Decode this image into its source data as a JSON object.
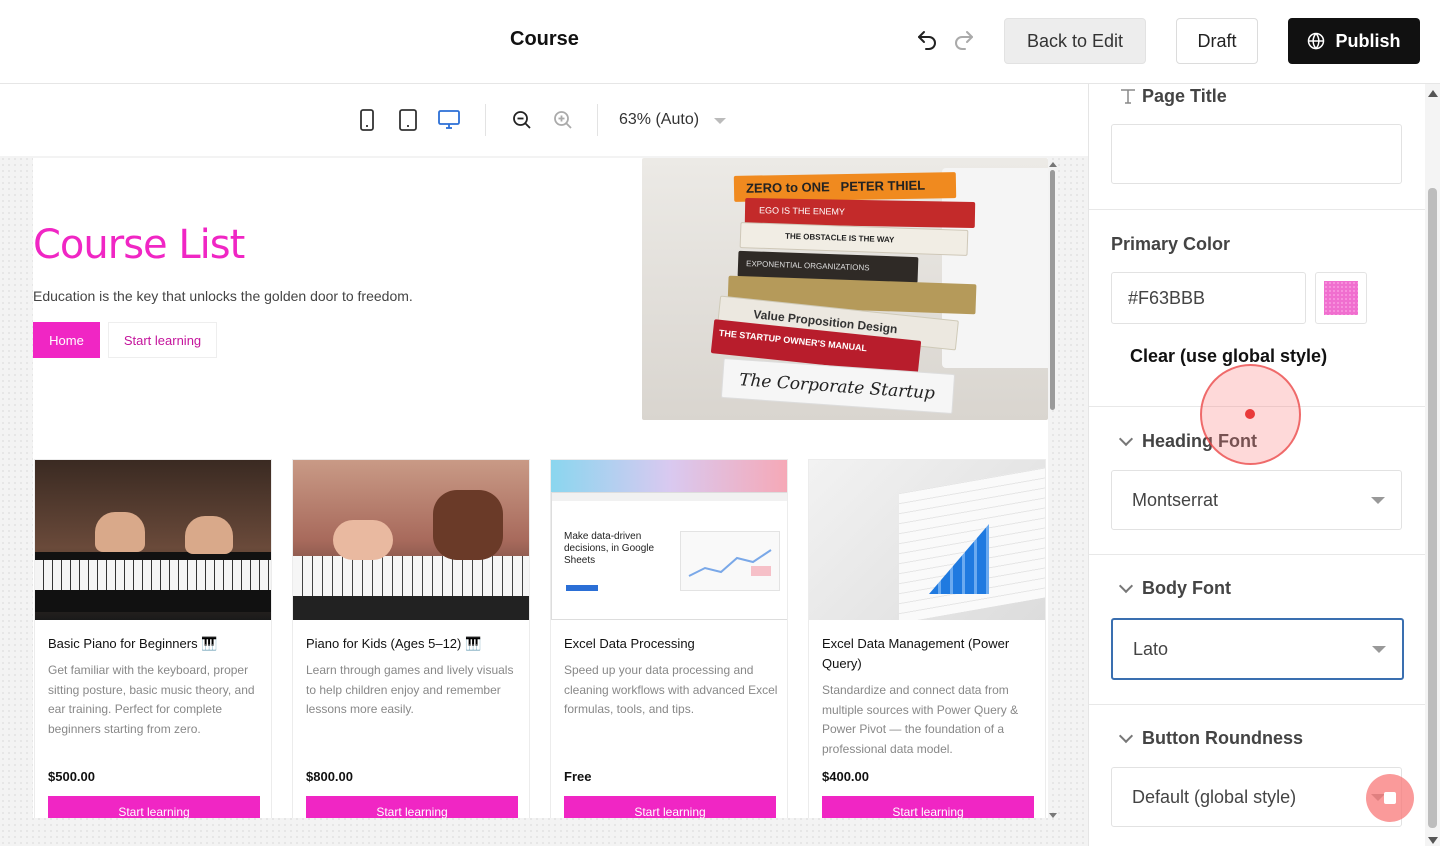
{
  "header": {
    "title": "Course",
    "back_label": "Back to Edit",
    "draft_label": "Draft",
    "publish_label": "Publish"
  },
  "viewbar": {
    "zoom_label": "63% (Auto)"
  },
  "hero": {
    "title": "Course List",
    "subtitle": "Education is the key that unlocks the golden door to freedom.",
    "primary_button": "Home",
    "secondary_button": "Start learning",
    "books": [
      "ZERO to ONE   PETER THIEL",
      "EGO IS THE ENEMY",
      "THE OBSTACLE IS THE WAY",
      "EXPONENTIAL ORGANIZATIONS",
      "Value Proposition Design",
      "THE STARTUP OWNER'S MANUAL",
      "The Corporate Startup"
    ]
  },
  "courses": [
    {
      "title": "Basic Piano for Beginners 🎹",
      "description": "Get familiar with the keyboard, proper sitting posture, basic music theory, and ear training. Perfect for complete beginners starting from zero.",
      "price": "$500.00",
      "button": "Start learning"
    },
    {
      "title": "Piano for Kids (Ages 5–12) 🎹",
      "description": "Learn through games and lively visuals to help children enjoy and remember lessons more easily.",
      "price": "$800.00",
      "button": "Start learning"
    },
    {
      "title": "Excel Data Processing",
      "description": "Speed up your data processing and cleaning workflows with advanced Excel formulas, tools, and tips.",
      "price": "Free",
      "button": "Start learning",
      "image_text": "Make data-driven decisions, in Google Sheets"
    },
    {
      "title": "Excel Data Management (Power Query)",
      "description": "Standardize and connect data from multiple sources with Power Query & Power Pivot — the foundation of a professional data model.",
      "price": "$400.00",
      "button": "Start learning"
    }
  ],
  "panel": {
    "page_title_label": "Page Title",
    "page_title_value": "",
    "primary_color_label": "Primary Color",
    "primary_color_value": "#F63BBB",
    "clear_label": "Clear (use global style)",
    "heading_font_label": "Heading Font",
    "heading_font_value": "Montserrat",
    "body_font_label": "Body Font",
    "body_font_value": "Lato",
    "button_roundness_label": "Button Roundness",
    "button_roundness_value": "Default (global style)"
  },
  "colors": {
    "accent": "#f026c4",
    "primary_swatch": "#F63BBB",
    "focus_border": "#3a6fb0"
  }
}
